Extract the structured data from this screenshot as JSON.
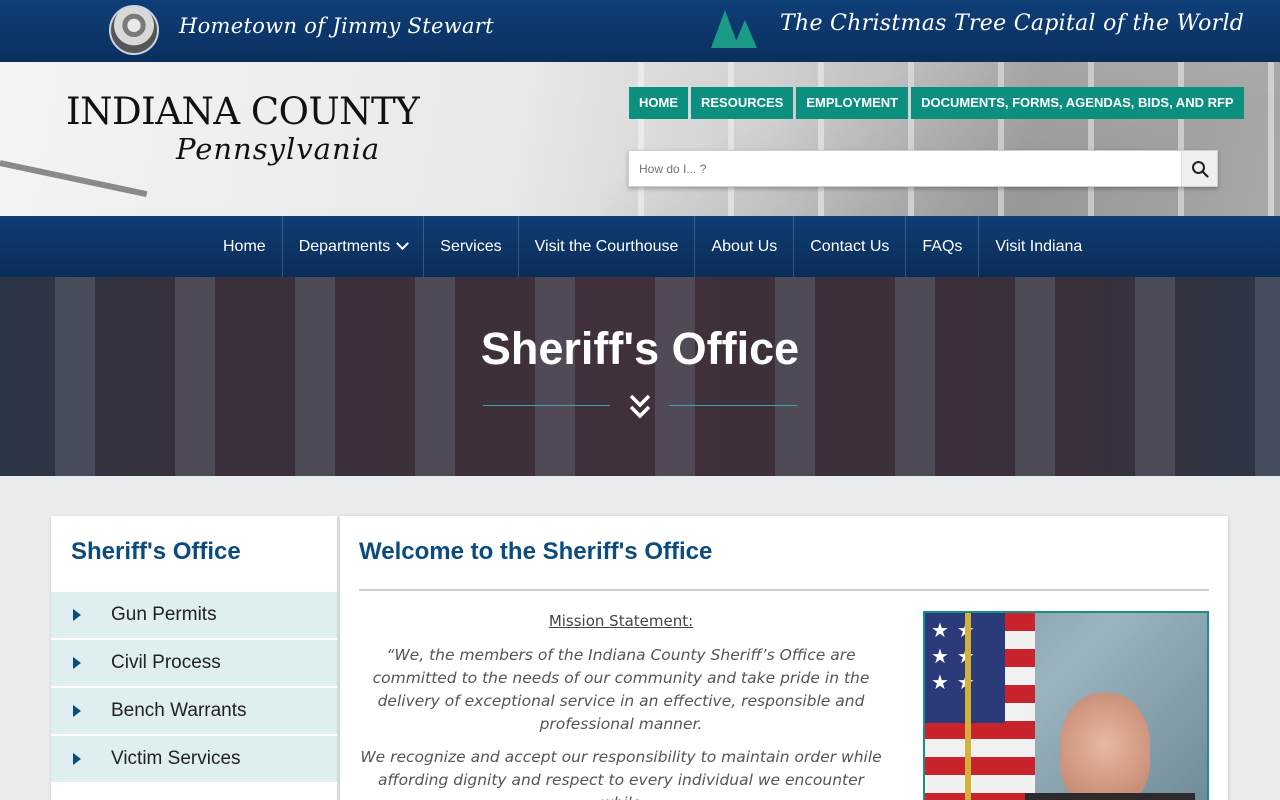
{
  "topbar": {
    "left_tagline": "Hometown of Jimmy Stewart",
    "right_tagline": "The Christmas Tree Capital of the World"
  },
  "logo": {
    "line1": "INDIANA COUNTY",
    "line2": "Pennsylvania"
  },
  "utility_nav": [
    {
      "label": "HOME"
    },
    {
      "label": "RESOURCES"
    },
    {
      "label": "EMPLOYMENT"
    },
    {
      "label": "DOCUMENTS, FORMS, AGENDAS, BIDS, AND RFP"
    }
  ],
  "search": {
    "placeholder": "How do I... ?",
    "icon": "search-icon"
  },
  "main_nav": [
    {
      "label": "Home"
    },
    {
      "label": "Departments"
    },
    {
      "label": "Services"
    },
    {
      "label": "Visit the Courthouse"
    },
    {
      "label": "About Us"
    },
    {
      "label": "Contact Us"
    },
    {
      "label": "FAQs"
    },
    {
      "label": "Visit Indiana"
    }
  ],
  "hero": {
    "title": "Sheriff's Office"
  },
  "sidebar": {
    "title": "Sheriff's Office",
    "items": [
      {
        "label": "Gun Permits"
      },
      {
        "label": "Civil Process"
      },
      {
        "label": "Bench Warrants"
      },
      {
        "label": "Victim Services"
      }
    ]
  },
  "content": {
    "title": "Welcome to the Sheriff's Office",
    "mission_heading": "Mission Statement:",
    "mission_p1": "“We, the members of the Indiana County Sheriff’s Office are committed to the needs of our community and take pride in the delivery of exceptional service in an effective, responsible and professional manner.",
    "mission_p2": "We recognize and accept our responsibility to maintain order while affording dignity and respect to every individual we encounter while"
  },
  "colors": {
    "navy": "#0b4b7d",
    "teal": "#0d8f7f",
    "sidebar_item_bg": "#dfeeee"
  }
}
